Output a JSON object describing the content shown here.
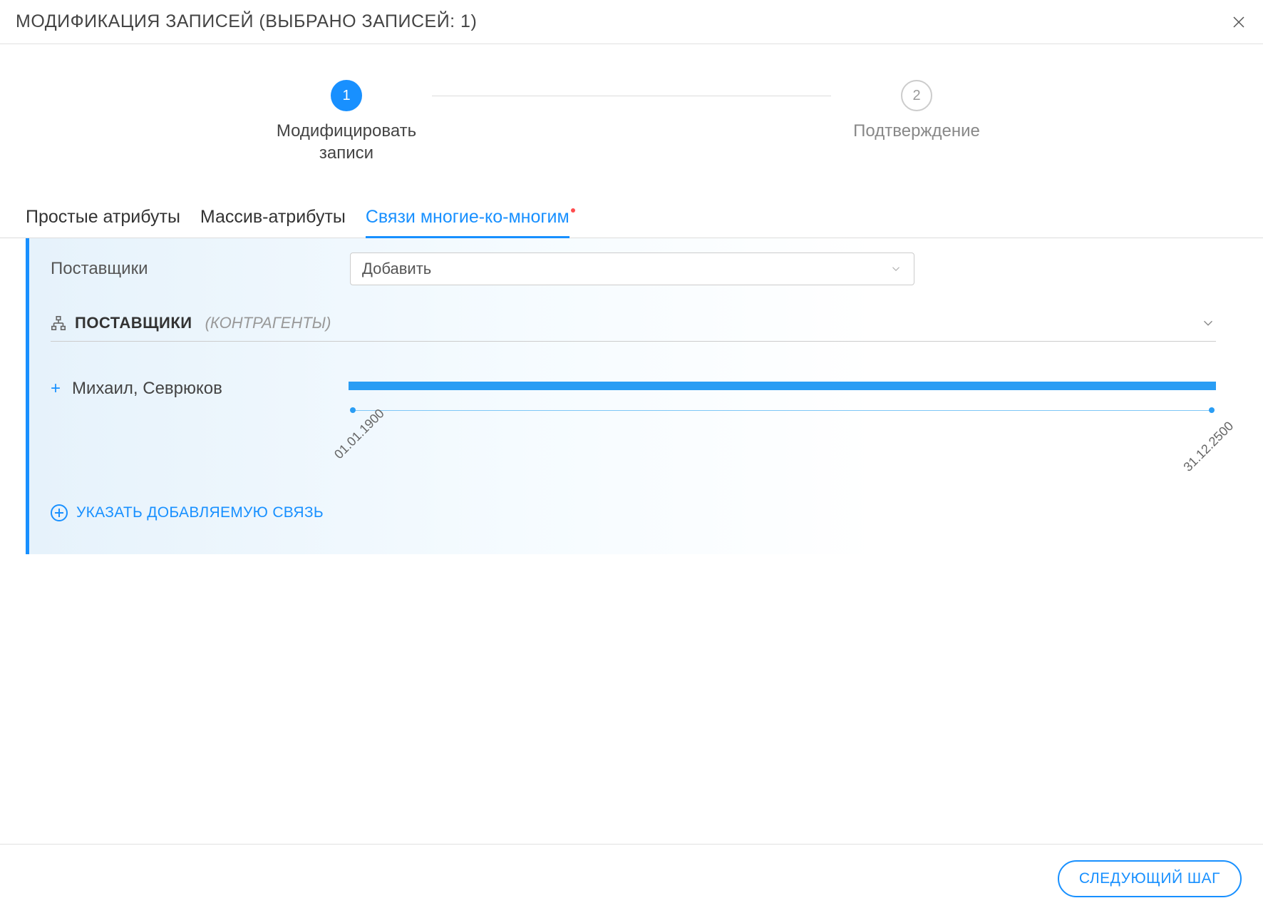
{
  "header": {
    "title": "МОДИФИКАЦИЯ ЗАПИСЕЙ (ВЫБРАНО ЗАПИСЕЙ: 1)"
  },
  "steps": {
    "step1_number": "1",
    "step1_label": "Модифицировать записи",
    "step2_number": "2",
    "step2_label": "Подтверждение"
  },
  "tabs": {
    "tab1": "Простые атрибуты",
    "tab2": "Массив-атрибуты",
    "tab3": "Связи многие-ко-многим"
  },
  "form": {
    "label": "Поставщики",
    "select_value": "Добавить"
  },
  "section": {
    "title": "ПОСТАВЩИКИ",
    "subtitle": "(КОНТРАГЕНТЫ)"
  },
  "item": {
    "name": "Михаил, Севрюков",
    "date_start": "01.01.1900",
    "date_end": "31.12.2500"
  },
  "actions": {
    "add_link": "УКАЗАТЬ ДОБАВЛЯЕМУЮ СВЯЗЬ"
  },
  "footer": {
    "next_button": "СЛЕДУЮЩИЙ ШАГ"
  }
}
